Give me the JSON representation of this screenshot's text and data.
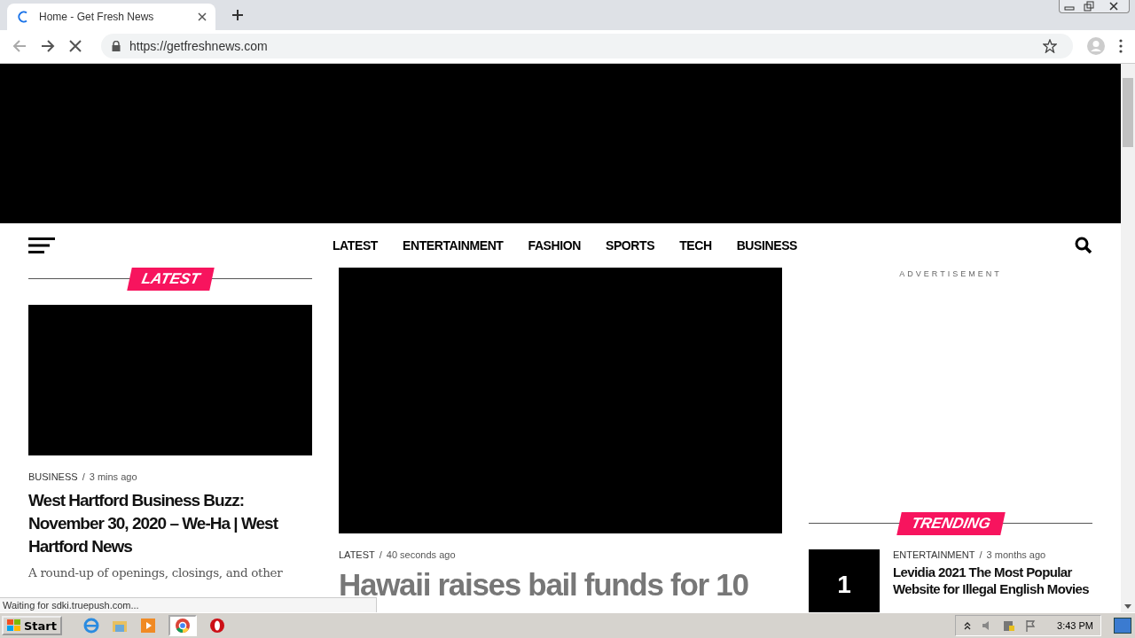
{
  "browser": {
    "tab": {
      "title": "Home - Get Fresh News",
      "loading": true
    },
    "url": "https://getfreshnews.com"
  },
  "nav": {
    "items": [
      "LATEST",
      "ENTERTAINMENT",
      "FASHION",
      "SPORTS",
      "TECH",
      "BUSINESS"
    ]
  },
  "latest": {
    "heading": "LATEST",
    "article": {
      "category": "BUSINESS",
      "separator": "/",
      "time": "3 mins ago",
      "title": "West Hartford Business Buzz: November 30, 2020 – We-Ha | West Hartford News",
      "excerpt": "A round-up of openings, closings, and other"
    }
  },
  "featured": {
    "category": "LATEST",
    "separator": "/",
    "time": "40 seconds ago",
    "title": "Hawaii raises bail funds for 10"
  },
  "sidebar": {
    "ad_label": "ADVERTISEMENT",
    "trending_heading": "TRENDING",
    "trending": [
      {
        "rank": "1",
        "category": "ENTERTAINMENT",
        "separator": "/",
        "time": "3 months ago",
        "title": "Levidia 2021 The Most Popular Website for Illegal English Movies"
      }
    ]
  },
  "status_bubble": "Waiting for sdki.truepush.com...",
  "taskbar": {
    "start": "Start",
    "clock": "3:43 PM"
  }
}
